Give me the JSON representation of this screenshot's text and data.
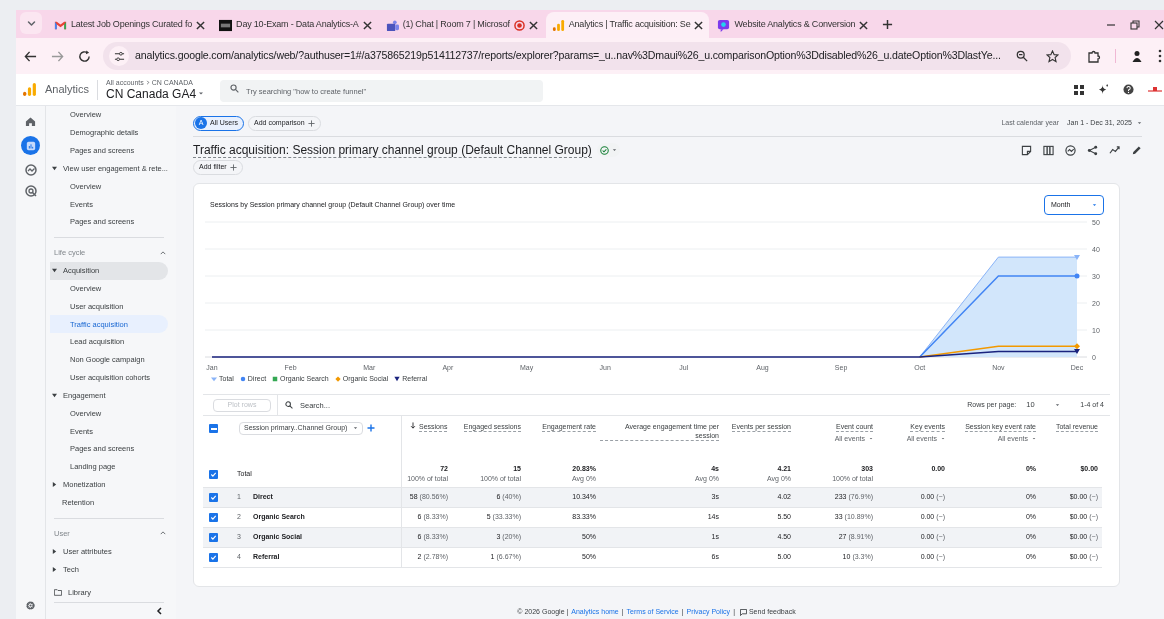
{
  "browser": {
    "tabs": [
      {
        "kind": "gmail",
        "title": "Latest Job Openings Curated fo",
        "selected": false,
        "recording": false
      },
      {
        "kind": "d2l",
        "title": "Day 10-Exam - Data Analytics-A",
        "selected": false,
        "recording": false
      },
      {
        "kind": "teams",
        "title": "(1) Chat | Room 7 | Microsof",
        "selected": false,
        "recording": true
      },
      {
        "kind": "analytics",
        "title": "Analytics | Traffic acquisition: Se",
        "selected": true,
        "recording": false
      },
      {
        "kind": "chat",
        "title": "Website Analytics & Conversion",
        "selected": false,
        "recording": false
      }
    ],
    "url": "analytics.google.com/analytics/web/?authuser=1#/a375865219p514112737/reports/explorer?params=_u..nav%3Dmaui%26_u.comparisonOption%3Ddisabled%26_u.dateOption%3DlastYe..."
  },
  "header": {
    "product": "Analytics",
    "breadcrumb": [
      "All accounts",
      "CN CANADA"
    ],
    "property": "CN Canada GA4",
    "search": {
      "placeholder": "Try searching \"how to create funnel\""
    }
  },
  "sidebar": {
    "nav": [
      {
        "kind": "continued",
        "children": [
          {
            "label": "Overview",
            "selected": false
          },
          {
            "label": "Demographic details",
            "selected": false
          },
          {
            "label": "Pages and screens",
            "selected": false
          }
        ]
      },
      {
        "kind": "group",
        "label": "View user engagement & rete...",
        "expanded": true,
        "active": false,
        "children": [
          {
            "label": "Overview",
            "selected": false
          },
          {
            "label": "Events",
            "selected": false
          },
          {
            "label": "Pages and screens",
            "selected": false
          }
        ]
      }
    ],
    "sections": [
      {
        "label": "Life cycle",
        "expanded": true,
        "items": [
          {
            "kind": "group",
            "label": "Acquisition",
            "expanded": true,
            "active": true,
            "children": [
              {
                "label": "Overview",
                "selected": false
              },
              {
                "label": "User acquisition",
                "selected": false
              },
              {
                "label": "Traffic acquisition",
                "selected": true
              },
              {
                "label": "Lead acquisition",
                "selected": false
              },
              {
                "label": "Non Google campaign",
                "selected": false
              },
              {
                "label": "User acquisition cohorts",
                "selected": false
              }
            ]
          },
          {
            "kind": "group",
            "label": "Engagement",
            "expanded": true,
            "active": false,
            "children": [
              {
                "label": "Overview",
                "selected": false
              },
              {
                "label": "Events",
                "selected": false
              },
              {
                "label": "Pages and screens",
                "selected": false
              },
              {
                "label": "Landing page",
                "selected": false
              }
            ]
          },
          {
            "kind": "group",
            "label": "Monetization",
            "expanded": false,
            "active": false
          },
          {
            "kind": "leaf",
            "label": "Retention"
          }
        ]
      },
      {
        "label": "User",
        "expanded": true,
        "items": [
          {
            "kind": "group",
            "label": "User attributes",
            "expanded": false,
            "active": false
          },
          {
            "kind": "group",
            "label": "Tech",
            "expanded": false,
            "active": false
          }
        ]
      }
    ],
    "library": "Library"
  },
  "report": {
    "comparisons": [
      {
        "badge": "A",
        "label": "All Users"
      }
    ],
    "add_comparison": "Add comparison",
    "date_label": "Last calendar year",
    "date_range": "Jan 1 - Dec 31, 2025",
    "title": "Traffic acquisition: Session primary channel group (Default Channel Group)",
    "add_filter": "Add filter",
    "chart": {
      "title": "Sessions by Session primary channel group (Default Channel Group) over time",
      "granularity": "Month",
      "chart_data": {
        "type": "line",
        "grid": true,
        "categories": [
          "Jan",
          "Feb",
          "Mar",
          "Apr",
          "May",
          "Jun",
          "Jul",
          "Aug",
          "Sep",
          "Oct",
          "Nov",
          "Dec"
        ],
        "ylim": [
          0,
          50
        ],
        "yticks": [
          0,
          10,
          20,
          30,
          40,
          50
        ],
        "series": [
          {
            "name": "Total",
            "color": "#8ab4f8",
            "values": [
              null,
              null,
              null,
              null,
              null,
              null,
              null,
              null,
              null,
              0,
              37,
              37
            ]
          },
          {
            "name": "Direct",
            "color": "#4285f4",
            "values": [
              null,
              null,
              null,
              null,
              null,
              null,
              null,
              null,
              null,
              0,
              30,
              30
            ]
          },
          {
            "name": "Organic Search",
            "color": "#34a853",
            "values": [
              null,
              null,
              null,
              null,
              null,
              null,
              null,
              null,
              null,
              null,
              null,
              null
            ]
          },
          {
            "name": "Organic Social",
            "color": "#f29900",
            "values": [
              null,
              null,
              null,
              null,
              null,
              null,
              null,
              null,
              null,
              0,
              4,
              4
            ]
          },
          {
            "name": "Referral",
            "color": "#1a237e",
            "values": [
              0,
              0,
              0,
              0,
              0,
              0,
              0,
              0,
              0,
              0,
              2,
              2
            ]
          }
        ]
      }
    },
    "table": {
      "plot_rows": "Plot rows",
      "search_placeholder": "Search...",
      "rows_per_page_label": "Rows per page:",
      "rows_per_page": "10",
      "range": "1-4 of 4",
      "select_all_indeterminate": true,
      "dimension": "Session primary..Channel Group)",
      "columns": [
        {
          "label": "Sessions",
          "sorted": true
        },
        {
          "label": "Engaged sessions",
          "sorted": false
        },
        {
          "label": "Engagement rate",
          "sorted": false
        },
        {
          "label": "Average engagement time per session",
          "sorted": false
        },
        {
          "label": "Events per session",
          "sorted": false
        },
        {
          "label": "Event count",
          "sorted": false,
          "filter": "All events"
        },
        {
          "label": "Key events",
          "sorted": false,
          "filter": "All events"
        },
        {
          "label": "Session key event rate",
          "sorted": false,
          "filter": "All events"
        },
        {
          "label": "Total revenue",
          "sorted": false
        }
      ],
      "total": {
        "label": "Total",
        "checked": true,
        "cells": [
          {
            "value": "72",
            "note": "100% of total"
          },
          {
            "value": "15",
            "note": "100% of total"
          },
          {
            "value": "20.83%",
            "note": "Avg 0%"
          },
          {
            "value": "4s",
            "note": "Avg 0%"
          },
          {
            "value": "4.21",
            "note": "Avg 0%"
          },
          {
            "value": "303",
            "note": "100% of total"
          },
          {
            "value": "0.00"
          },
          {
            "value": "0%"
          },
          {
            "value": "$0.00"
          }
        ]
      },
      "rows": [
        {
          "index": "1",
          "label": "Direct",
          "checked": true,
          "cells": [
            {
              "value": "58",
              "share": "(80.56%)"
            },
            {
              "value": "6",
              "share": "(40%)"
            },
            {
              "value": "10.34%"
            },
            {
              "value": "3s"
            },
            {
              "value": "4.02"
            },
            {
              "value": "233",
              "share": "(76.9%)"
            },
            {
              "value": "0.00",
              "share": "(−)"
            },
            {
              "value": "0%"
            },
            {
              "value": "$0.00",
              "share": "(−)"
            }
          ]
        },
        {
          "index": "2",
          "label": "Organic Search",
          "checked": true,
          "cells": [
            {
              "value": "6",
              "share": "(8.33%)"
            },
            {
              "value": "5",
              "share": "(33.33%)"
            },
            {
              "value": "83.33%"
            },
            {
              "value": "14s"
            },
            {
              "value": "5.50"
            },
            {
              "value": "33",
              "share": "(10.89%)"
            },
            {
              "value": "0.00",
              "share": "(−)"
            },
            {
              "value": "0%"
            },
            {
              "value": "$0.00",
              "share": "(−)"
            }
          ]
        },
        {
          "index": "3",
          "label": "Organic Social",
          "checked": true,
          "cells": [
            {
              "value": "6",
              "share": "(8.33%)"
            },
            {
              "value": "3",
              "share": "(20%)"
            },
            {
              "value": "50%"
            },
            {
              "value": "1s"
            },
            {
              "value": "4.50"
            },
            {
              "value": "27",
              "share": "(8.91%)"
            },
            {
              "value": "0.00",
              "share": "(−)"
            },
            {
              "value": "0%"
            },
            {
              "value": "$0.00",
              "share": "(−)"
            }
          ]
        },
        {
          "index": "4",
          "label": "Referral",
          "checked": true,
          "cells": [
            {
              "value": "2",
              "share": "(2.78%)"
            },
            {
              "value": "1",
              "share": "(6.67%)"
            },
            {
              "value": "50%"
            },
            {
              "value": "6s"
            },
            {
              "value": "5.00"
            },
            {
              "value": "10",
              "share": "(3.3%)"
            },
            {
              "value": "0.00",
              "share": "(−)"
            },
            {
              "value": "0%"
            },
            {
              "value": "$0.00",
              "share": "(−)"
            }
          ]
        }
      ]
    }
  },
  "footer": [
    {
      "kind": "text",
      "text": "© 2026 Google |"
    },
    {
      "kind": "link",
      "text": "Analytics home"
    },
    {
      "kind": "text",
      "text": "|"
    },
    {
      "kind": "link",
      "text": "Terms of Service"
    },
    {
      "kind": "text",
      "text": "|"
    },
    {
      "kind": "link",
      "text": "Privacy Policy"
    },
    {
      "kind": "text",
      "text": "|"
    },
    {
      "kind": "feedback",
      "text": "Send feedback"
    }
  ]
}
